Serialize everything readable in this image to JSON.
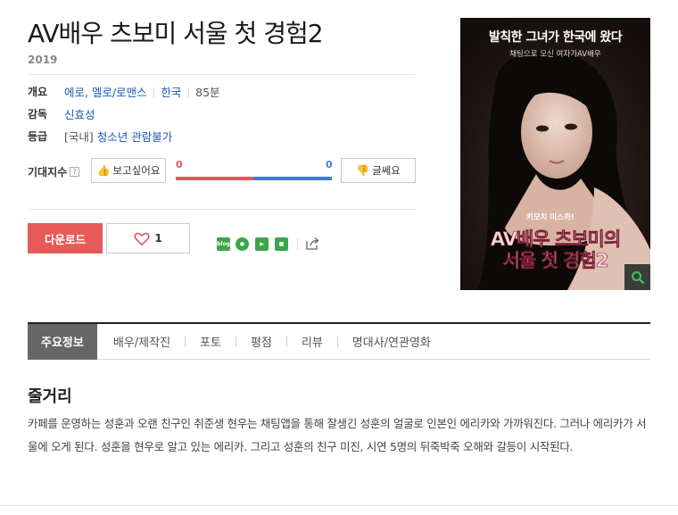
{
  "movie": {
    "title": "AV배우 츠보미 서울 첫 경험2",
    "year": "2019"
  },
  "info": {
    "overview_label": "개요",
    "genre": "에로, 멜로/로맨스",
    "country": "한국",
    "runtime": "85분",
    "director_label": "감독",
    "director": "신효성",
    "rating_label": "등급",
    "rating_prefix": "[국내]",
    "rating": "청소년 관람불가"
  },
  "expectation": {
    "label": "기대지수",
    "help_icon": "?",
    "want_label": "보고싶어요",
    "want_count": "0",
    "nope_label": "글쎄요",
    "nope_count": "0",
    "want_color": "#e8535b",
    "nope_color": "#3f7bd8"
  },
  "actions": {
    "download_label": "다운로드",
    "like_count": "1",
    "accent_color": "#e85a5a",
    "share_icons": [
      "blog",
      "talk",
      "story",
      "band"
    ]
  },
  "poster": {
    "top_text": "발칙한 그녀가 한국에 왔다",
    "sub_text": "채팅으로 모신 여자가AV배우",
    "small_text": "키모치 미스까!",
    "title_line1": "AV배우 츠보미의",
    "title_line2": "서울 첫 경험2"
  },
  "tabs": [
    {
      "label": "주요정보"
    },
    {
      "label": "배우/제작진"
    },
    {
      "label": "포토"
    },
    {
      "label": "평점"
    },
    {
      "label": "리뷰"
    },
    {
      "label": "명대사/연관영화"
    }
  ],
  "synopsis": {
    "heading": "줄거리",
    "text": "카페를 운영하는 성훈과 오랜 친구인 취준생 현우는 채팅앱을 통해 잘생긴 성훈의 얼굴로 인본인 에리카와 가까워진다. 그러나 에리카가 서울에 오게 된다. 성훈을 현우로 알고 있는 에리카. 그리고 성훈의 친구 미진, 시연 5명의 뒤죽박죽 오해와 갈등이 시작된다."
  }
}
